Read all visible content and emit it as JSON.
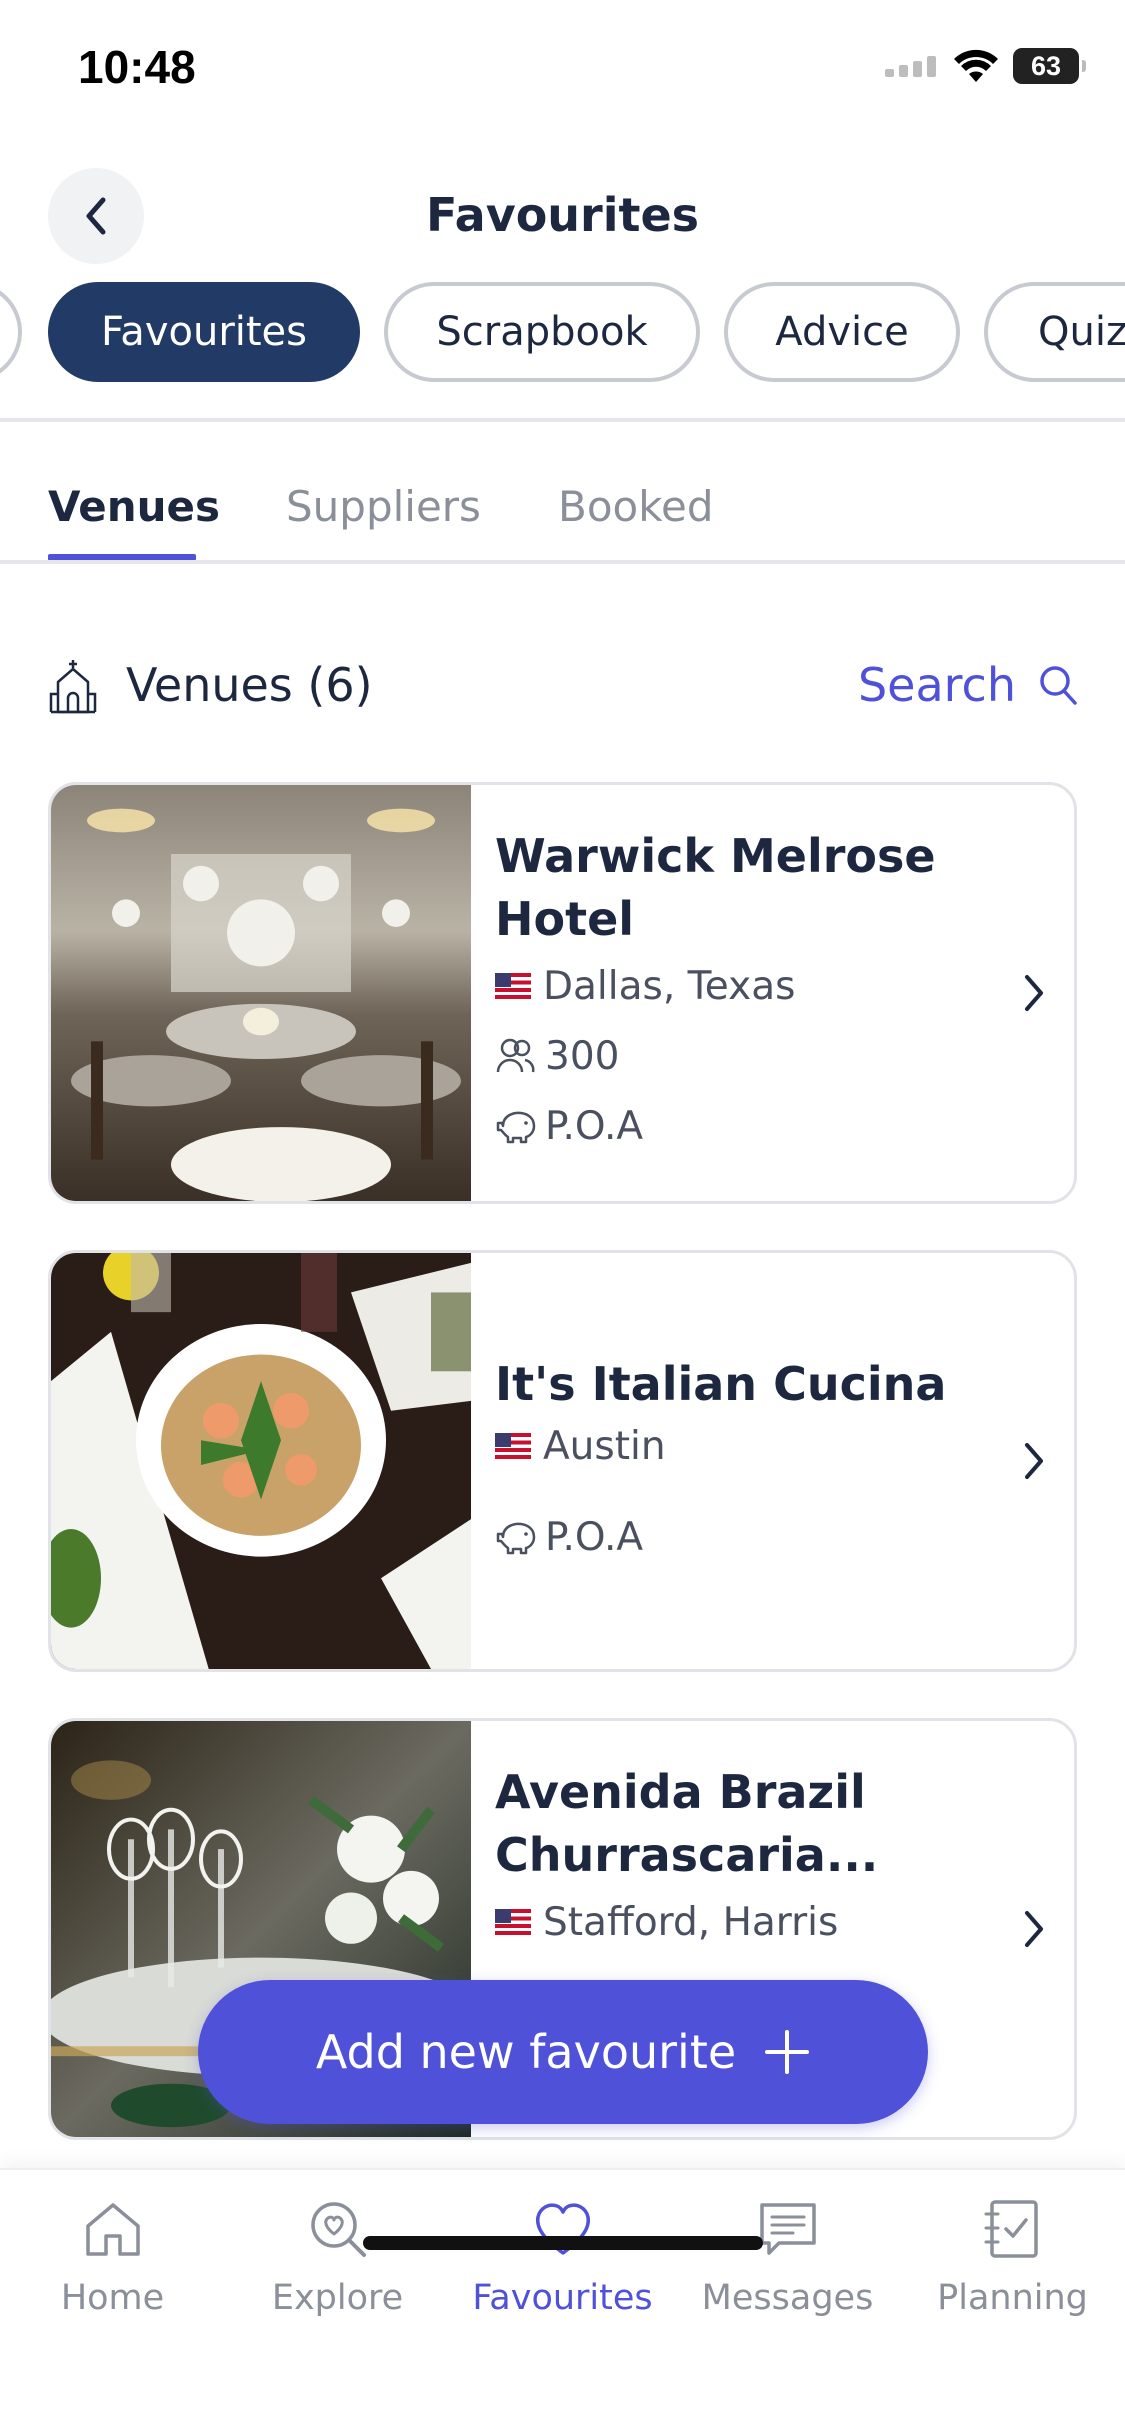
{
  "status": {
    "time": "10:48",
    "battery": "63"
  },
  "header": {
    "title": "Favourites"
  },
  "pills": [
    "Favourites",
    "Scrapbook",
    "Advice",
    "Quiz"
  ],
  "sub_tabs": [
    "Venues",
    "Suppliers",
    "Booked"
  ],
  "section": {
    "title": "Venues (6)",
    "search_label": "Search"
  },
  "venues": [
    {
      "name": "Warwick Melrose Hotel",
      "location": "Dallas, Texas",
      "capacity": "300",
      "price": "P.O.A"
    },
    {
      "name": "It's Italian Cucina",
      "location": "Austin",
      "price": "P.O.A"
    },
    {
      "name": "Avenida Brazil Churrascaria...",
      "location": "Stafford, Harris"
    }
  ],
  "fab": {
    "label": "Add new favourite"
  },
  "bottom_nav": [
    "Home",
    "Explore",
    "Favourites",
    "Messages",
    "Planning"
  ],
  "colors": {
    "accent": "#4f52d8",
    "navy": "#223a66",
    "text": "#1d2740",
    "muted": "#8a8f99"
  }
}
